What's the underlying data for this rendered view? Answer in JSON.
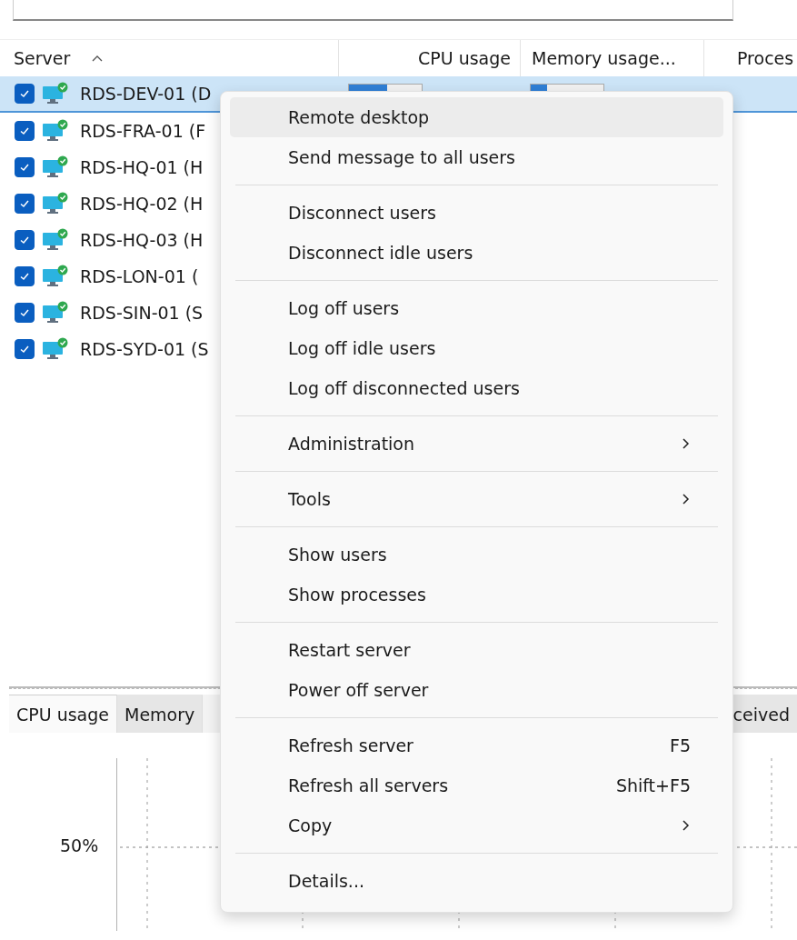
{
  "table": {
    "columns": [
      {
        "label": "Server",
        "sorted": true
      },
      {
        "label": "CPU usage",
        "sorted": false
      },
      {
        "label": "Memory usage...",
        "sorted": false
      },
      {
        "label": "Proces",
        "sorted": false
      }
    ],
    "rows": [
      {
        "name": "RDS-DEV-01 (D",
        "checked": true,
        "selected": true,
        "cpu": {
          "level": 0.52
        },
        "memory": {
          "level": 0.22
        }
      },
      {
        "name": "RDS-FRA-01 (F",
        "checked": true,
        "selected": false
      },
      {
        "name": "RDS-HQ-01 (H",
        "checked": true,
        "selected": false
      },
      {
        "name": "RDS-HQ-02 (H",
        "checked": true,
        "selected": false
      },
      {
        "name": "RDS-HQ-03 (H",
        "checked": true,
        "selected": false
      },
      {
        "name": "RDS-LON-01 (",
        "checked": true,
        "selected": false
      },
      {
        "name": "RDS-SIN-01 (S",
        "checked": true,
        "selected": false
      },
      {
        "name": "RDS-SYD-01 (S",
        "checked": true,
        "selected": false
      }
    ]
  },
  "bottom_tabs": [
    {
      "label": "CPU usage",
      "selected": true
    },
    {
      "label": "Memory",
      "selected": false
    },
    {
      "label": "ceived",
      "selected": false
    }
  ],
  "chart": {
    "tick_label": "50%"
  },
  "context_menu": {
    "groups": [
      [
        {
          "label": "Remote desktop",
          "selected": true
        },
        {
          "label": "Send message to all users",
          "selected": false
        }
      ],
      [
        {
          "label": "Disconnect users",
          "selected": false
        },
        {
          "label": "Disconnect idle users",
          "selected": false
        }
      ],
      [
        {
          "label": "Log off users",
          "selected": false
        },
        {
          "label": "Log off idle users",
          "selected": false
        },
        {
          "label": "Log off disconnected users",
          "selected": false
        }
      ],
      [
        {
          "label": "Administration",
          "selected": false,
          "submenu": true
        }
      ],
      [
        {
          "label": "Tools",
          "selected": false,
          "submenu": true
        }
      ],
      [
        {
          "label": "Show users",
          "selected": false
        },
        {
          "label": "Show processes",
          "selected": false
        }
      ],
      [
        {
          "label": "Restart server",
          "selected": false
        },
        {
          "label": "Power off server",
          "selected": false
        }
      ],
      [
        {
          "label": "Refresh server",
          "selected": false,
          "shortcut": "F5"
        },
        {
          "label": "Refresh all servers",
          "selected": false,
          "shortcut": "Shift+F5"
        },
        {
          "label": "Copy",
          "selected": false,
          "submenu": true
        }
      ],
      [
        {
          "label": "Details...",
          "selected": false
        }
      ]
    ]
  }
}
